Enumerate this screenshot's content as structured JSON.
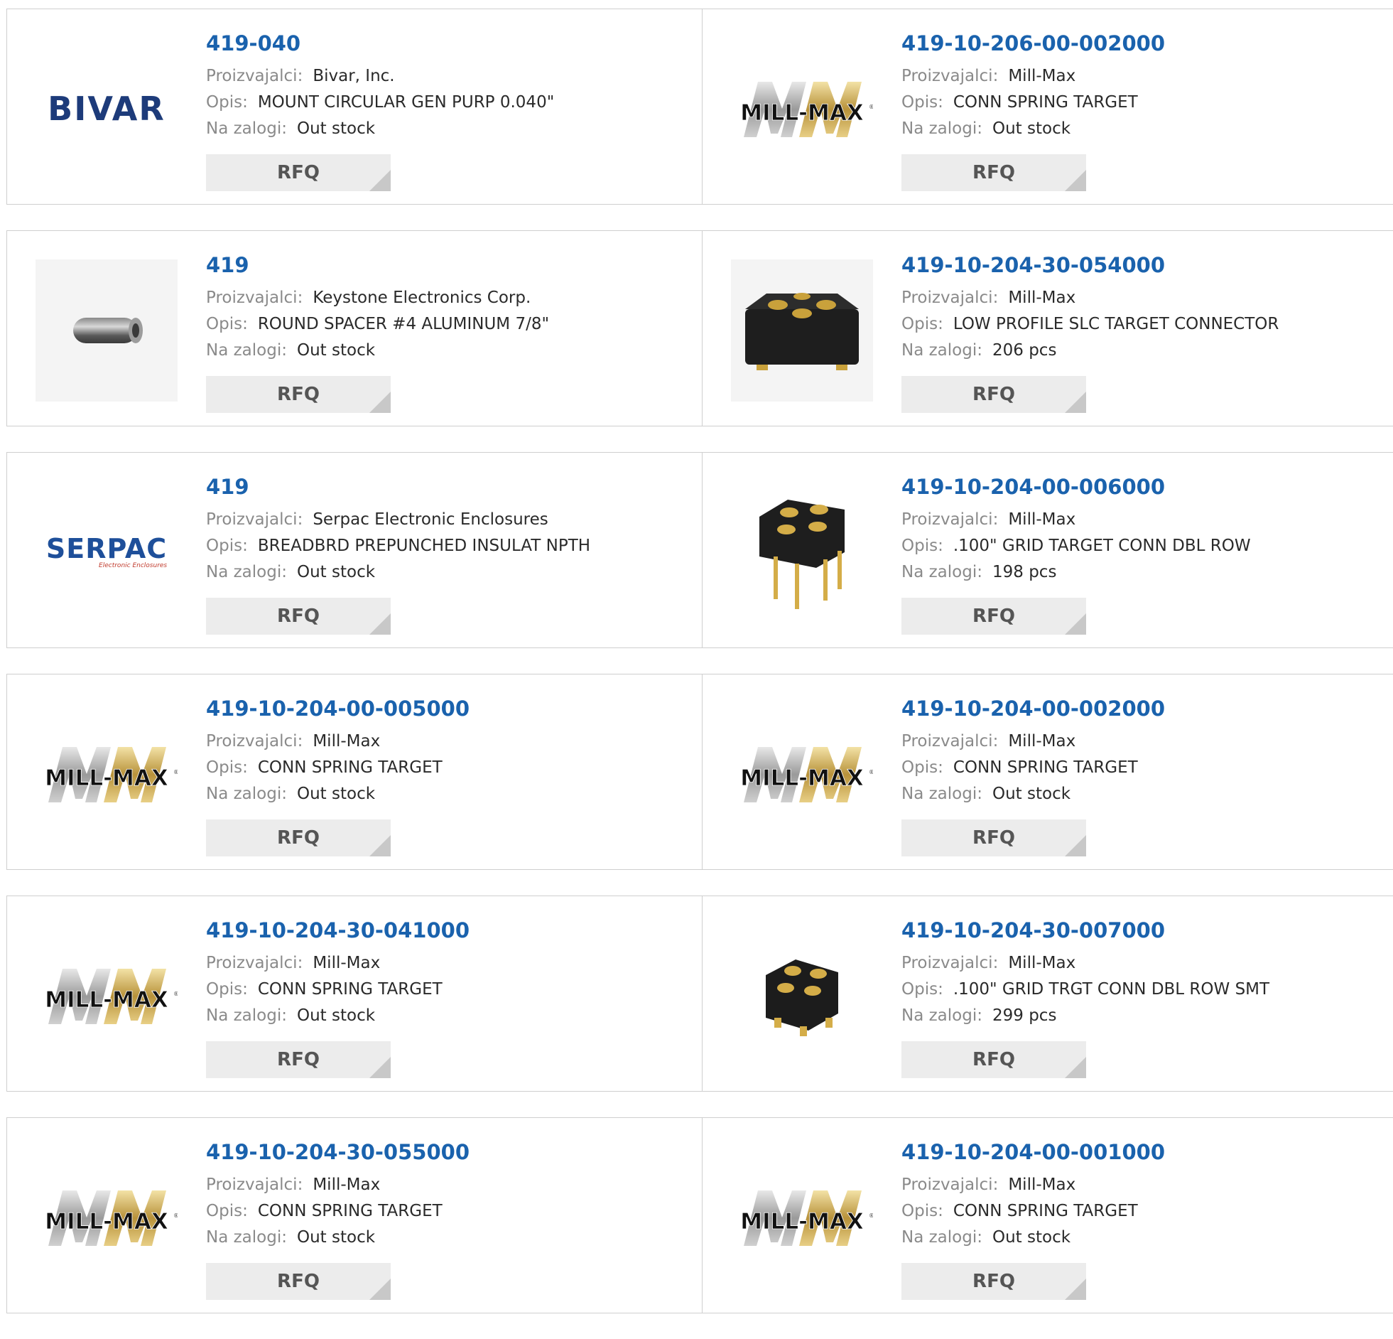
{
  "labels": {
    "manufacturer": "Proizvajalci:",
    "description": "Opis:",
    "stock": "Na zalogi:",
    "rfq": "RFQ"
  },
  "products": [
    {
      "pn": "419-040",
      "manufacturer": "Bivar, Inc.",
      "description": "MOUNT CIRCULAR GEN PURP 0.040\"",
      "stock": "Out stock",
      "image": "bivar-logo",
      "logo_text": "BIVAR"
    },
    {
      "pn": "419-10-206-00-002000",
      "manufacturer": "Mill-Max",
      "description": "CONN SPRING TARGET",
      "stock": "Out stock",
      "image": "mill-max-logo",
      "logo_text": "MILL-MAX"
    },
    {
      "pn": "419",
      "manufacturer": "Keystone Electronics Corp.",
      "description": "ROUND SPACER #4 ALUMINUM 7/8\"",
      "stock": "Out stock",
      "image": "spacer-photo"
    },
    {
      "pn": "419-10-204-30-054000",
      "manufacturer": "Mill-Max",
      "description": "LOW PROFILE SLC TARGET CONNECTOR",
      "stock": "206 pcs",
      "image": "low-profile-connector-photo"
    },
    {
      "pn": "419",
      "manufacturer": "Serpac Electronic Enclosures",
      "description": "BREADBRD PREPUNCHED INSULAT NPTH",
      "stock": "Out stock",
      "image": "serpac-logo",
      "logo_text": "SERPAC",
      "logo_subtext": "Electronic Enclosures"
    },
    {
      "pn": "419-10-204-00-006000",
      "manufacturer": "Mill-Max",
      "description": ".100\" GRID TARGET CONN DBL ROW",
      "stock": "198 pcs",
      "image": "pin-connector-photo"
    },
    {
      "pn": "419-10-204-00-005000",
      "manufacturer": "Mill-Max",
      "description": "CONN SPRING TARGET",
      "stock": "Out stock",
      "image": "mill-max-logo",
      "logo_text": "MILL-MAX"
    },
    {
      "pn": "419-10-204-00-002000",
      "manufacturer": "Mill-Max",
      "description": "CONN SPRING TARGET",
      "stock": "Out stock",
      "image": "mill-max-logo",
      "logo_text": "MILL-MAX"
    },
    {
      "pn": "419-10-204-30-041000",
      "manufacturer": "Mill-Max",
      "description": "CONN SPRING TARGET",
      "stock": "Out stock",
      "image": "mill-max-logo",
      "logo_text": "MILL-MAX"
    },
    {
      "pn": "419-10-204-30-007000",
      "manufacturer": "Mill-Max",
      "description": ".100\" GRID TRGT CONN DBL ROW SMT",
      "stock": "299 pcs",
      "image": "smt-connector-photo"
    },
    {
      "pn": "419-10-204-30-055000",
      "manufacturer": "Mill-Max",
      "description": "CONN SPRING TARGET",
      "stock": "Out stock",
      "image": "mill-max-logo",
      "logo_text": "MILL-MAX"
    },
    {
      "pn": "419-10-204-00-001000",
      "manufacturer": "Mill-Max",
      "description": "CONN SPRING TARGET",
      "stock": "Out stock",
      "image": "mill-max-logo",
      "logo_text": "MILL-MAX"
    }
  ],
  "colors": {
    "link": "#1a62ad",
    "label": "#8a8a8a",
    "value": "#2a2a2a",
    "border": "#cfcfcf",
    "rfq_bg": "#ececec",
    "rfq_text": "#555555"
  }
}
